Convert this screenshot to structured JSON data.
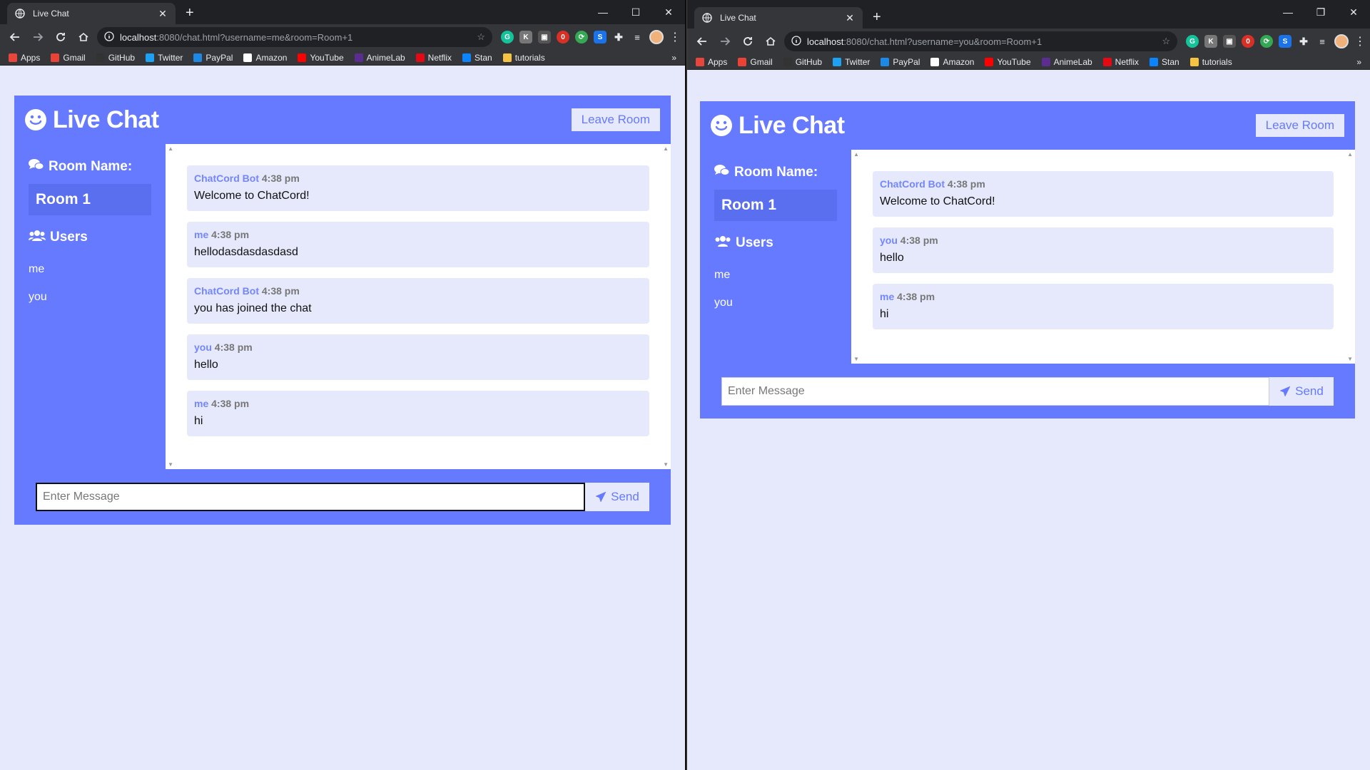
{
  "left": {
    "tab_title": "Live Chat",
    "url_host": "localhost",
    "url_rest": ":8080/chat.html?username=me&room=Room+1",
    "app_title": "Live Chat",
    "leave_label": "Leave Room",
    "room_heading": "Room Name:",
    "room_name": "Room 1",
    "users_heading": "Users",
    "users": [
      "me",
      "you"
    ],
    "messages": [
      {
        "user": "ChatCord Bot",
        "time": "4:38 pm",
        "text": "Welcome to ChatCord!"
      },
      {
        "user": "me",
        "time": "4:38 pm",
        "text": "hellodasdasdasdasd"
      },
      {
        "user": "ChatCord Bot",
        "time": "4:38 pm",
        "text": "you has joined the chat"
      },
      {
        "user": "you",
        "time": "4:38 pm",
        "text": "hello"
      },
      {
        "user": "me",
        "time": "4:38 pm",
        "text": "hi"
      }
    ],
    "input_placeholder": "Enter Message",
    "send_label": "Send"
  },
  "right": {
    "tab_title": "Live Chat",
    "url_host": "localhost",
    "url_rest": ":8080/chat.html?username=you&room=Room+1",
    "app_title": "Live Chat",
    "leave_label": "Leave Room",
    "room_heading": "Room Name:",
    "room_name": "Room 1",
    "users_heading": "Users",
    "users": [
      "me",
      "you"
    ],
    "messages": [
      {
        "user": "ChatCord Bot",
        "time": "4:38 pm",
        "text": "Welcome to ChatCord!"
      },
      {
        "user": "you",
        "time": "4:38 pm",
        "text": "hello"
      },
      {
        "user": "me",
        "time": "4:38 pm",
        "text": "hi"
      }
    ],
    "input_placeholder": "Enter Message",
    "send_label": "Send"
  },
  "bookmarks": [
    {
      "label": "Apps",
      "icon": "apps-grid-icon",
      "color": "#e8453c"
    },
    {
      "label": "Gmail",
      "icon": "gmail-icon",
      "color": "#ea4335"
    },
    {
      "label": "GitHub",
      "icon": "github-icon",
      "color": "#333333"
    },
    {
      "label": "Twitter",
      "icon": "twitter-icon",
      "color": "#1da1f2"
    },
    {
      "label": "PayPal",
      "icon": "paypal-icon",
      "color": "#1e88e5"
    },
    {
      "label": "Amazon",
      "icon": "amazon-icon",
      "color": "#ffffff"
    },
    {
      "label": "YouTube",
      "icon": "youtube-icon",
      "color": "#ff0000"
    },
    {
      "label": "AnimeLab",
      "icon": "animelab-icon",
      "color": "#5b2d90"
    },
    {
      "label": "Netflix",
      "icon": "netflix-icon",
      "color": "#e50914"
    },
    {
      "label": "Stan",
      "icon": "stan-icon",
      "color": "#0a84ff"
    },
    {
      "label": "tutorials",
      "icon": "folder-icon",
      "color": "#f6c343"
    }
  ],
  "colors": {
    "primary": "#667aff",
    "light": "#e6e9fc",
    "room_box": "#5a6ef0",
    "username": "#7386ff"
  }
}
